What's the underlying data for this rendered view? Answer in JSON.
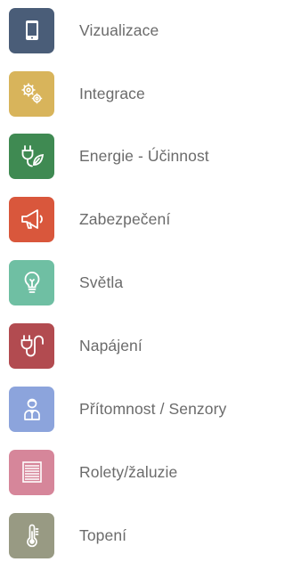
{
  "items": [
    {
      "label": "Vizualizace",
      "icon": "tablet-icon",
      "color": "#4a5d78"
    },
    {
      "label": "Integrace",
      "icon": "gears-icon",
      "color": "#d8b45b"
    },
    {
      "label": "Energie - Účinnost",
      "icon": "plug-leaf-icon",
      "color": "#3f8a52"
    },
    {
      "label": "Zabezpečení",
      "icon": "megaphone-icon",
      "color": "#d9573c"
    },
    {
      "label": "Světla",
      "icon": "lightbulb-icon",
      "color": "#6fbfa3"
    },
    {
      "label": "Napájení",
      "icon": "power-cable-icon",
      "color": "#b24b50"
    },
    {
      "label": "Přítomnost / Senzory",
      "icon": "person-icon",
      "color": "#8ca4dc"
    },
    {
      "label": "Rolety/žaluzie",
      "icon": "blinds-icon",
      "color": "#d6869a"
    },
    {
      "label": "Topení",
      "icon": "thermometer-icon",
      "color": "#989a83"
    }
  ]
}
